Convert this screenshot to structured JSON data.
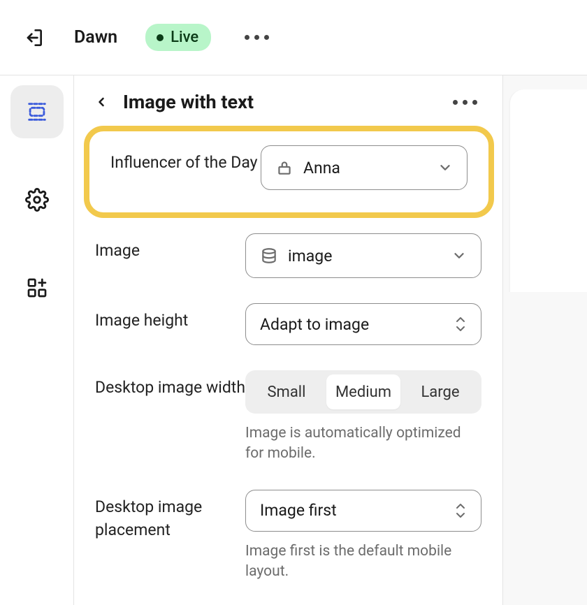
{
  "topbar": {
    "theme_name": "Dawn",
    "status_label": "Live"
  },
  "panel": {
    "title": "Image with text"
  },
  "fields": {
    "influencer": {
      "label": "Influencer of the Day",
      "value": "Anna"
    },
    "image": {
      "label": "Image",
      "value": "image"
    },
    "image_height": {
      "label": "Image height",
      "value": "Adapt to image"
    },
    "desktop_width": {
      "label": "Desktop image width",
      "options": [
        "Small",
        "Medium",
        "Large"
      ],
      "selected": "Medium",
      "help": "Image is automatically optimized for mobile."
    },
    "desktop_placement": {
      "label": "Desktop image placement",
      "value": "Image first",
      "help": "Image first is the default mobile layout."
    }
  }
}
